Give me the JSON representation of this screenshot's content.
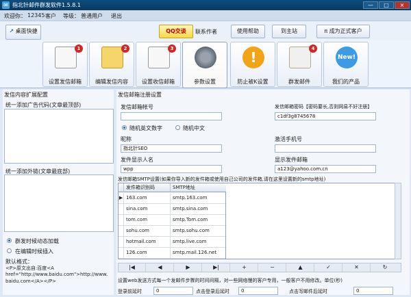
{
  "window": {
    "title": "指北针邮件群发软件1.5.8.1",
    "min": "—",
    "max": "□",
    "close": "×"
  },
  "info": {
    "welcome": "欢迎你：",
    "user_id": "12345",
    "user_suffix": "客户",
    "level_label": "等级：",
    "level": "普通用户",
    "logout": "退出"
  },
  "toolbar": {
    "desktop_shortcut": "桌面快捷",
    "qq_chat": "QQ交谈",
    "contact_author": "联系作者",
    "help": "使用帮助",
    "to_site": "到主站",
    "upgrade": "成为正式客户"
  },
  "tabs": [
    {
      "label": "设置发信邮箱",
      "badge": "1"
    },
    {
      "label": "编辑发信内容",
      "badge": "2"
    },
    {
      "label": "设置收信邮箱",
      "badge": "3"
    },
    {
      "label": "参数设置",
      "badge": ""
    },
    {
      "label": "防止被K设置",
      "badge": ""
    },
    {
      "label": "群发邮件",
      "badge": "4"
    },
    {
      "label": "我们的产品",
      "badge": ""
    }
  ],
  "left": {
    "section_title": "发信内容扩展配置",
    "top_ad_label": "统一添加广告代码(文章最顶部)",
    "bottom_link_label": "统一添加外链(文章最底部)",
    "opt_dynamic": "群发时候动态加载",
    "opt_insert": "在编辑时候插入",
    "default_format_label": "默认格式：",
    "default_format_1": "<P>原文出自:百度<A",
    "default_format_2": "href=\"http://www.baidu.com\">http://www.",
    "default_format_3": "baidu.com</A></P>"
  },
  "right": {
    "section_title": "发信邮箱注册设置",
    "account_label": "发信邮箱帐号",
    "password_label": "发信邮箱密码【密码要长,否则网易不好注册】",
    "password_value": "c1df3g8745678",
    "opt_random_alnum": "随机英文数字",
    "opt_random_cn": "随机中文",
    "nickname_label": "昵称",
    "nickname_value": "指北针SEO",
    "phone_label": "激活手机号",
    "display_name_label": "发件显示人名",
    "display_name_value": "wpp",
    "display_email_label": "显示发件邮箱",
    "display_email_value": "a123@yahoo.com.cn",
    "smtp_note": "发信邮箱SMTP设置(如果你导入新的发件箱或使用自己公司的发件箱,请在这里设置新的smtp地址)",
    "grid_headers": [
      "发件箱识别码",
      "SMTP地址"
    ],
    "grid_rows": [
      [
        "163.com",
        "smtp.163.com"
      ],
      [
        "sina.com",
        "smtp.sina.com"
      ],
      [
        "tom.com",
        "smtp.Tom.com"
      ],
      [
        "sohu.com",
        "smtp.sohu.com"
      ],
      [
        "hotmail.com",
        "smtp.live.com"
      ],
      [
        "126.com",
        "smtp.mail.126.net"
      ]
    ],
    "nav_buttons": [
      "|◀",
      "◀",
      "▶",
      "▶|",
      "+",
      "−",
      "▲",
      "✓",
      "✕",
      "↻"
    ],
    "web_delay_note": "设置web发送方式每一个发邮件步骤的时间间隔，对一些网络慢的客户专用，一般客户不用修改。单位(秒)",
    "delay_fields": [
      {
        "label": "登录前延时",
        "value": "0"
      },
      {
        "label": "点击登录后延时",
        "value": "0"
      },
      {
        "label": "点击写邮件后延时",
        "value": "0"
      }
    ]
  }
}
